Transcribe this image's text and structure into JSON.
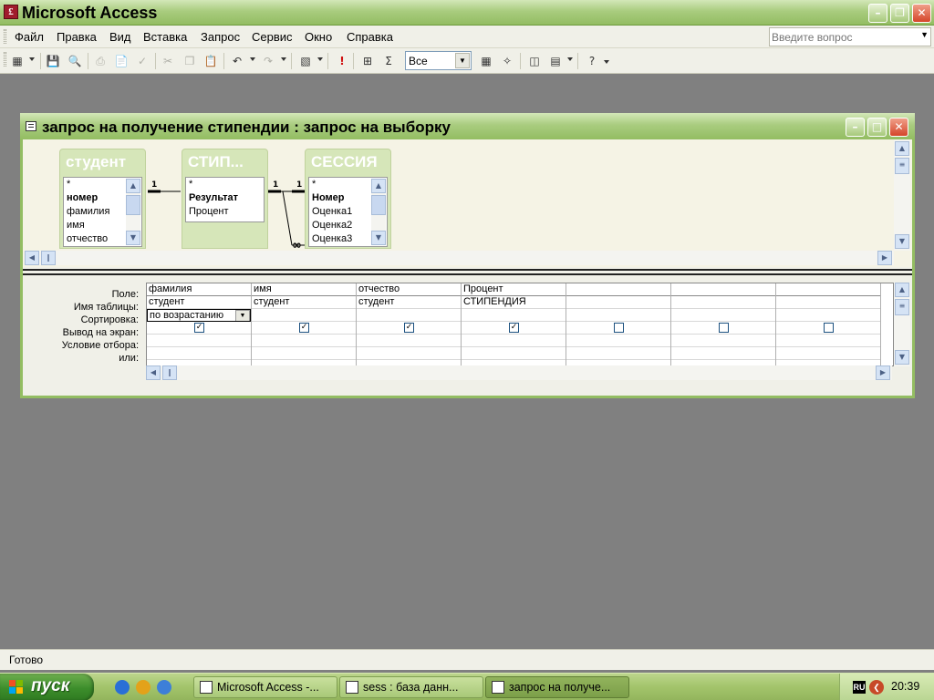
{
  "app": {
    "title": "Microsoft Access",
    "icon_letter": "£"
  },
  "menu": {
    "items": [
      "Файл",
      "Правка",
      "Вид",
      "Вставка",
      "Запрос",
      "Сервис",
      "Окно",
      "Справка"
    ],
    "help_placeholder": "Введите вопрос"
  },
  "toolbar": {
    "top_values": "Все"
  },
  "query_window": {
    "title": "запрос на получение стипендии : запрос на выборку",
    "tables": [
      {
        "name": "студент",
        "fields": [
          "*",
          "номер",
          "фамилия",
          "имя",
          "отчество"
        ],
        "primary_key": "номер"
      },
      {
        "name": "СТИП...",
        "fields": [
          "*",
          "Результат",
          "Процент"
        ],
        "primary_key": "Результат"
      },
      {
        "name": "СЕССИЯ",
        "fields": [
          "*",
          "Номер",
          "Оценка1",
          "Оценка2",
          "Оценка3"
        ],
        "primary_key": "Номер"
      }
    ],
    "relations": {
      "one": "1",
      "many": "∞"
    },
    "row_labels": [
      "Поле:",
      "Имя таблицы:",
      "Сортировка:",
      "Вывод на экран:",
      "Условие отбора:",
      "или:"
    ],
    "columns": [
      {
        "field": "фамилия",
        "table": "студент",
        "sort": "по возрастанию",
        "show": true
      },
      {
        "field": "имя",
        "table": "студент",
        "sort": "",
        "show": true
      },
      {
        "field": "отчество",
        "table": "студент",
        "sort": "",
        "show": true
      },
      {
        "field": "Процент",
        "table": "СТИПЕНДИЯ",
        "sort": "",
        "show": true
      },
      {
        "field": "",
        "table": "",
        "sort": "",
        "show": false
      },
      {
        "field": "",
        "table": "",
        "sort": "",
        "show": false
      },
      {
        "field": "",
        "table": "",
        "sort": "",
        "show": false
      }
    ]
  },
  "status": {
    "text": "Готово"
  },
  "taskbar": {
    "start_label": "пуск",
    "tasks": [
      {
        "label": "Microsoft Access -...",
        "active": false
      },
      {
        "label": "sess : база данн...",
        "active": false
      },
      {
        "label": "запрос на получе...",
        "active": true
      }
    ],
    "lang": "RU",
    "clock": "20:39"
  },
  "colors": {
    "title_green": "#93bd62",
    "taskbar_green": "#a3c46b",
    "start_green": "#3c8d2b",
    "workspace": "#808080"
  }
}
